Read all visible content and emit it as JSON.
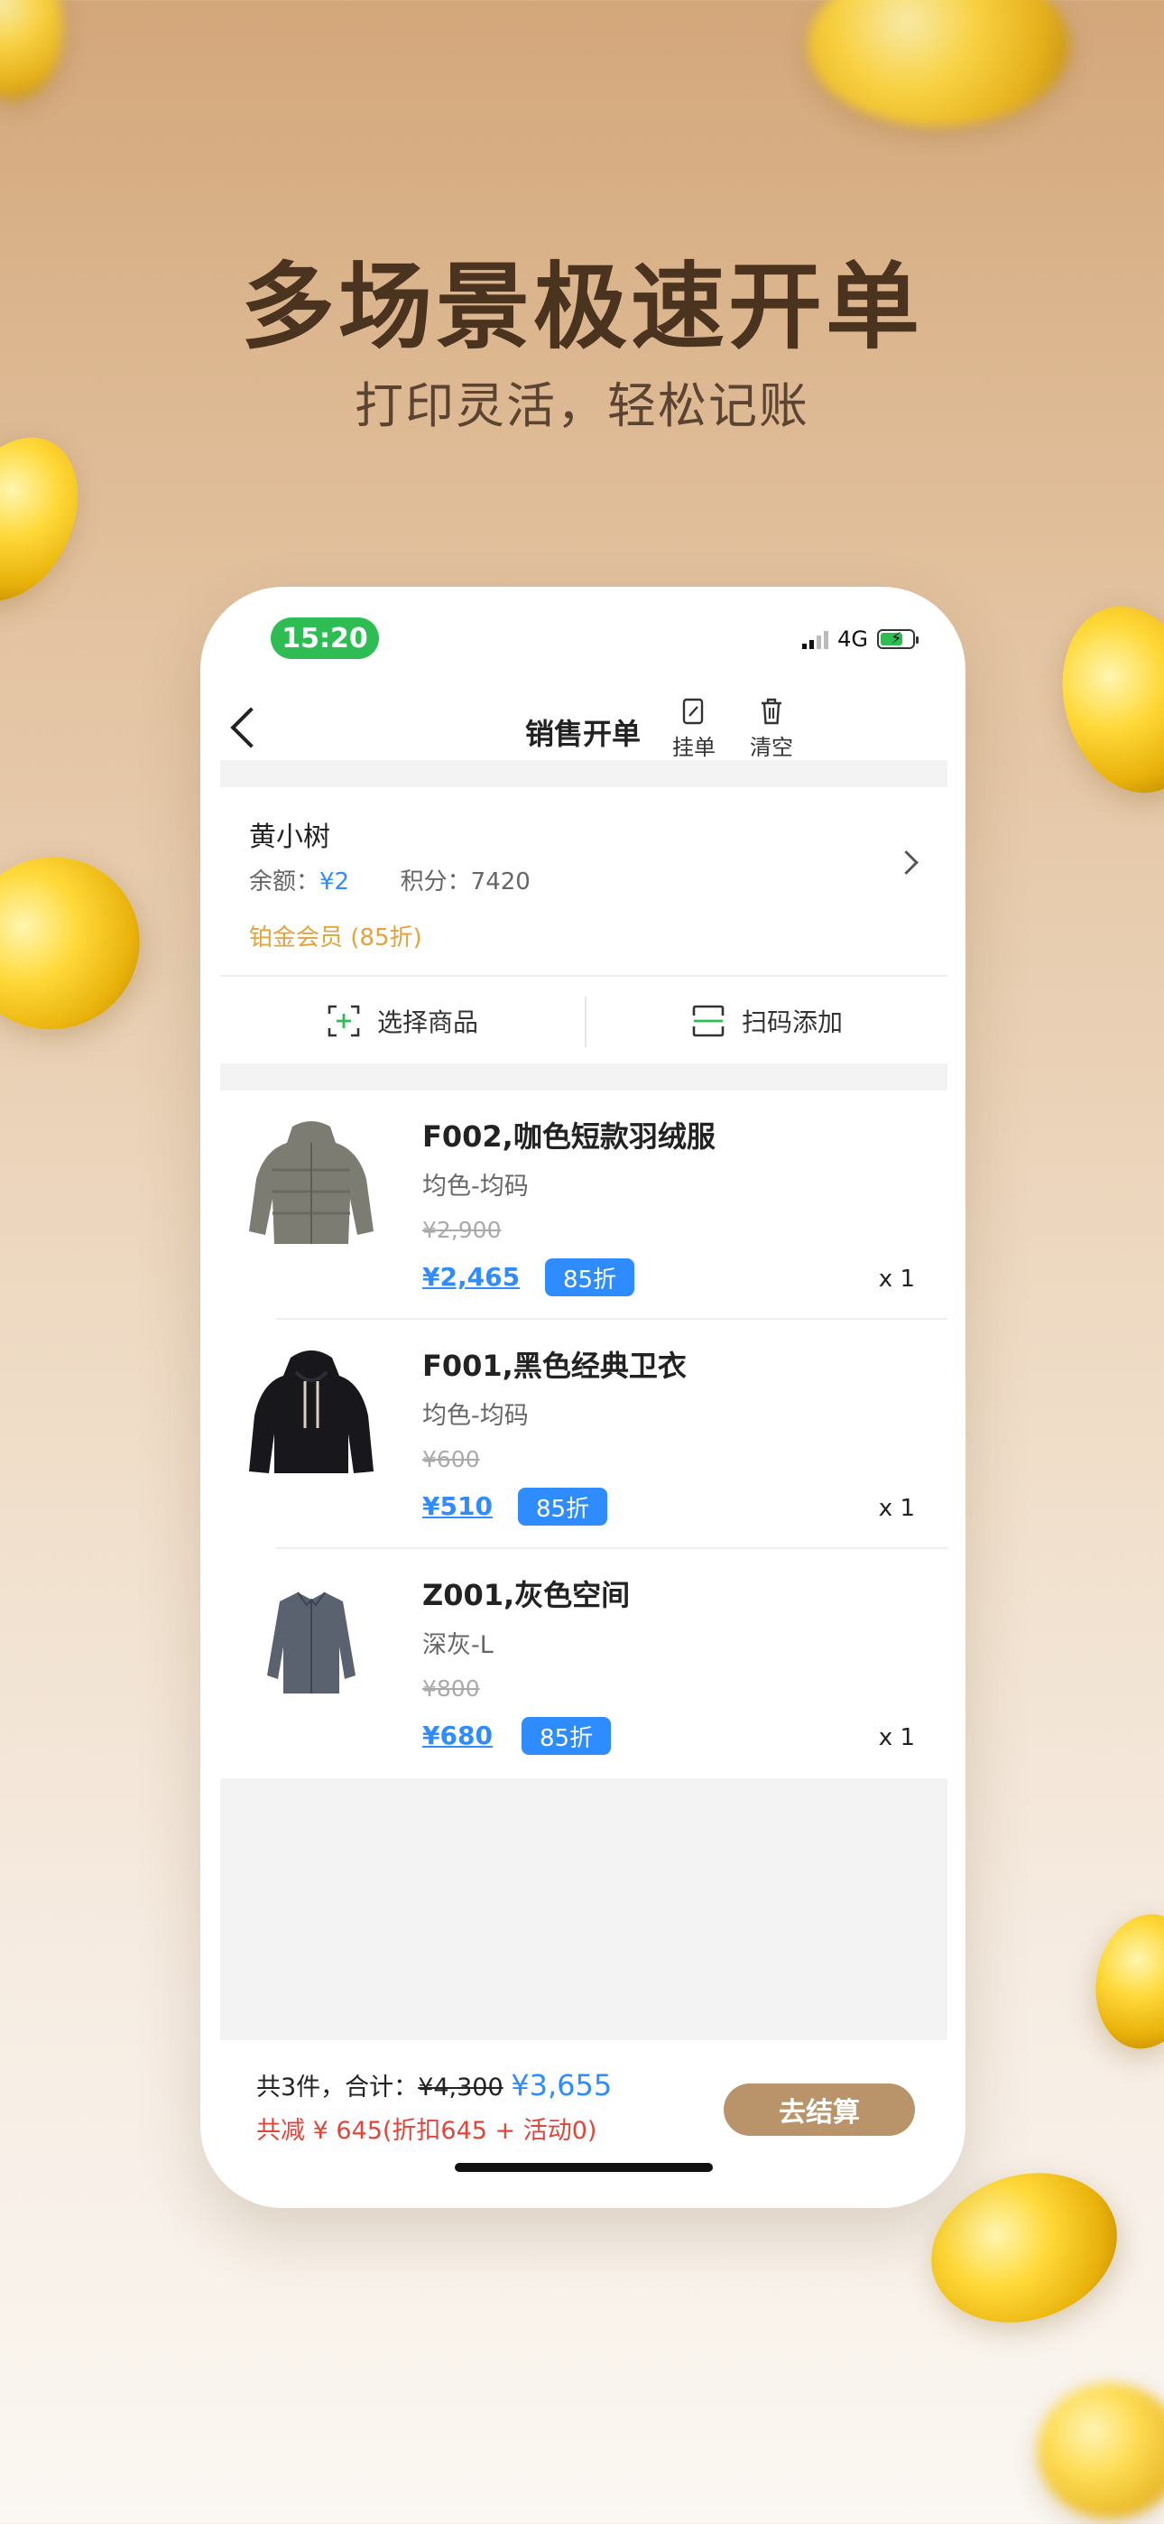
{
  "promo": {
    "headline": "多场景极速开单",
    "subline": "打印灵活，轻松记账"
  },
  "status_bar": {
    "time": "15:20",
    "network": "4G"
  },
  "nav": {
    "title": "销售开单",
    "hold_label": "挂单",
    "clear_label": "清空"
  },
  "member": {
    "name": "黄小树",
    "balance_label": "余额：",
    "balance_value": "¥2",
    "points_label": "积分：",
    "points_value": "7420",
    "level": "铂金会员 (85折)"
  },
  "actions": {
    "select_label": "选择商品",
    "scan_label": "扫码添加"
  },
  "items": [
    {
      "title": "F002,咖色短款羽绒服",
      "spec": "均色-均码",
      "orig_price": "¥2,900",
      "price": "¥2,465",
      "discount": "85折",
      "qty": "x 1"
    },
    {
      "title": "F001,黑色经典卫衣",
      "spec": "均色-均码",
      "orig_price": "¥600",
      "price": "¥510",
      "discount": "85折",
      "qty": "x 1"
    },
    {
      "title": "Z001,灰色空间",
      "spec": "深灰-L",
      "orig_price": "¥800",
      "price": "¥680",
      "discount": "85折",
      "qty": "x 1"
    }
  ],
  "footer": {
    "count_label": "共3件，合计：",
    "orig_total": "¥4,300",
    "total": "¥3,655",
    "savings": "共减 ¥ 645(折扣645 + 活动0)",
    "checkout_label": "去结算"
  },
  "colors": {
    "accent_blue": "#2f8cff",
    "member_gold": "#e3a33a",
    "checkout_btn": "#b9936a",
    "savings_red": "#e0453a",
    "time_green": "#2ebd52"
  }
}
